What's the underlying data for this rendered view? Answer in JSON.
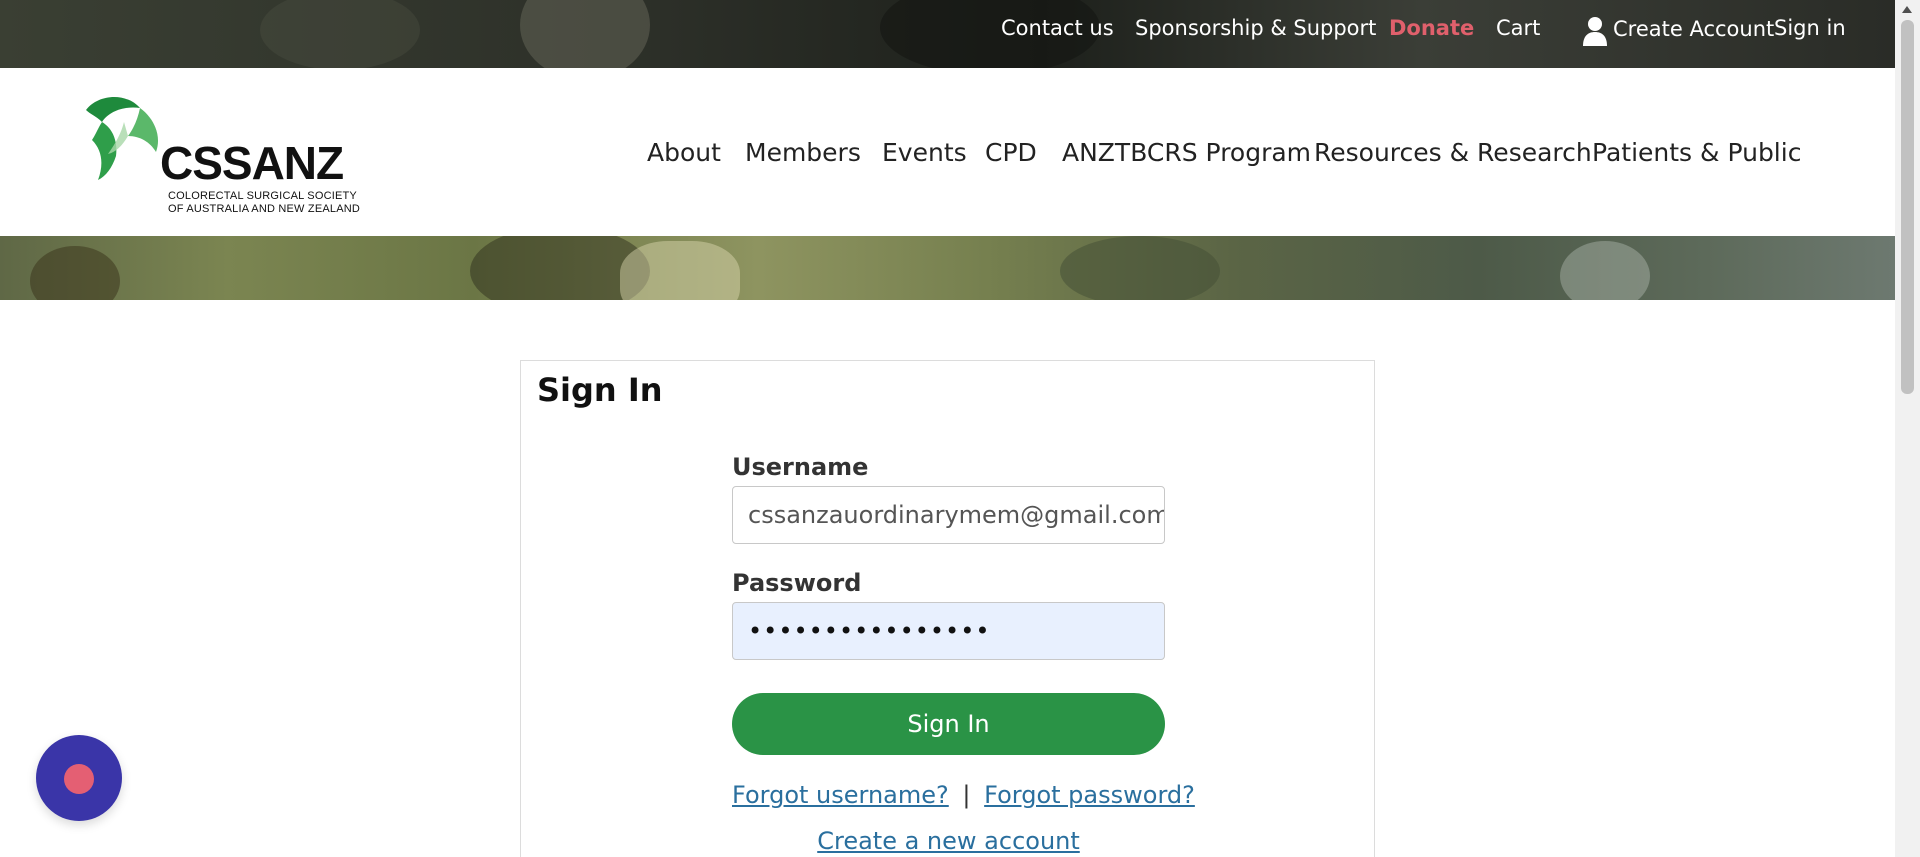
{
  "topbar": {
    "contact": "Contact us",
    "sponsorship": "Sponsorship & Support",
    "donate": "Donate",
    "cart": "Cart",
    "create_account": "Create Account",
    "sign_in": "Sign in"
  },
  "logo": {
    "word": "CSSANZ",
    "line1": "COLORECTAL SURGICAL SOCIETY",
    "line2": "OF AUSTRALIA AND NEW ZEALAND"
  },
  "nav": {
    "items": [
      "About",
      "Members",
      "Events",
      "CPD",
      "ANZTBCRS Program",
      "Resources & Research",
      "Patients & Public"
    ]
  },
  "signin": {
    "title": "Sign In",
    "username_label": "Username",
    "username_value": "cssanzauordinarymem@gmail.com",
    "password_label": "Password",
    "password_value": "••••••••••••••••",
    "button": "Sign In",
    "forgot_username": "Forgot username?",
    "separator": "|",
    "forgot_password": "Forgot password?",
    "create_account": "Create a new account"
  },
  "colors": {
    "donate": "#e0606c",
    "primary_button": "#2a9346",
    "link": "#2a6f9e",
    "chat_bubble": "#3a35a8",
    "chat_dot": "#e45f73"
  },
  "icons": {
    "user": "user-icon",
    "chat": "chat-bubble-icon"
  }
}
